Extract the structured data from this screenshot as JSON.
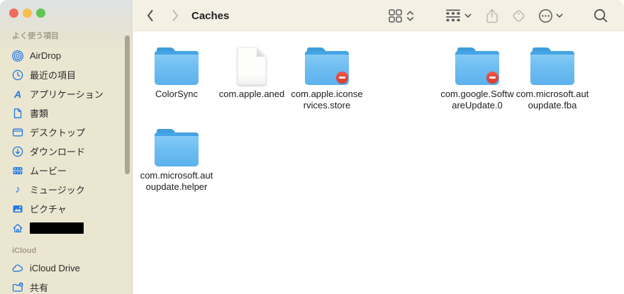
{
  "window": {
    "traffic_lights": [
      {
        "name": "close",
        "color": "#ee6a5f"
      },
      {
        "name": "minimize",
        "color": "#f5bf4f"
      },
      {
        "name": "zoom",
        "color": "#61c554"
      }
    ]
  },
  "toolbar": {
    "title": "Caches",
    "back_icon": "chevron-left",
    "forward_icon": "chevron-right",
    "view_icon": "grid-view",
    "view_chevrons_icon": "up-down-chevrons",
    "group_icon": "group-by",
    "group_chevron_icon": "chevron-down",
    "share_icon": "share",
    "tag_icon": "tag",
    "more_icon": "ellipsis-circle",
    "more_chevron_icon": "chevron-down",
    "search_icon": "magnifier"
  },
  "sidebar": {
    "sections": [
      {
        "header": "よく使う項目",
        "items": [
          {
            "label": "AirDrop",
            "icon": "airdrop-icon"
          },
          {
            "label": "最近の項目",
            "icon": "clock-icon"
          },
          {
            "label": "アプリケーション",
            "icon": "applications-icon"
          },
          {
            "label": "書類",
            "icon": "documents-icon"
          },
          {
            "label": "デスクトップ",
            "icon": "desktop-icon"
          },
          {
            "label": "ダウンロード",
            "icon": "downloads-icon"
          },
          {
            "label": "ムービー",
            "icon": "movies-icon"
          },
          {
            "label": "ミュージック",
            "icon": "music-icon"
          },
          {
            "label": "ピクチャ",
            "icon": "pictures-icon"
          },
          {
            "label": "",
            "icon": "home-icon",
            "redacted": true
          }
        ]
      },
      {
        "header": "iCloud",
        "items": [
          {
            "label": "iCloud Drive",
            "icon": "icloud-icon"
          },
          {
            "label": "共有",
            "icon": "shared-folder-icon"
          }
        ]
      }
    ]
  },
  "files": [
    {
      "name": "ColorSync",
      "type": "folder",
      "badge": false,
      "lines": [
        "ColorSync"
      ]
    },
    {
      "name": "com.apple.aned",
      "type": "file",
      "badge": false,
      "lines": [
        "com.apple.aned"
      ]
    },
    {
      "name": "com.apple.iconservices.store",
      "type": "folder",
      "badge": true,
      "lines": [
        "com.apple.iconse",
        "rvices.store"
      ]
    },
    {
      "name": "com.google.SoftwareUpdate.0",
      "type": "folder",
      "badge": true,
      "lines": [
        "com.google.Softw",
        "areUpdate.0"
      ]
    },
    {
      "name": "com.microsoft.autoupdate.fba",
      "type": "folder",
      "badge": false,
      "lines": [
        "com.microsoft.aut",
        "oupdate.fba"
      ]
    },
    {
      "name": "com.microsoft.autoupdate.helper",
      "type": "folder",
      "badge": false,
      "lines": [
        "com.microsoft.aut",
        "oupdate.helper"
      ]
    }
  ],
  "colors": {
    "accent_blue": "#2178e4",
    "folder_body": "#6dbdf1",
    "folder_tab": "#3e9edd",
    "badge_red": "#e8463a",
    "sidebar_bg": "#ebe6d0",
    "toolbar_bg": "#f4f1e4"
  }
}
